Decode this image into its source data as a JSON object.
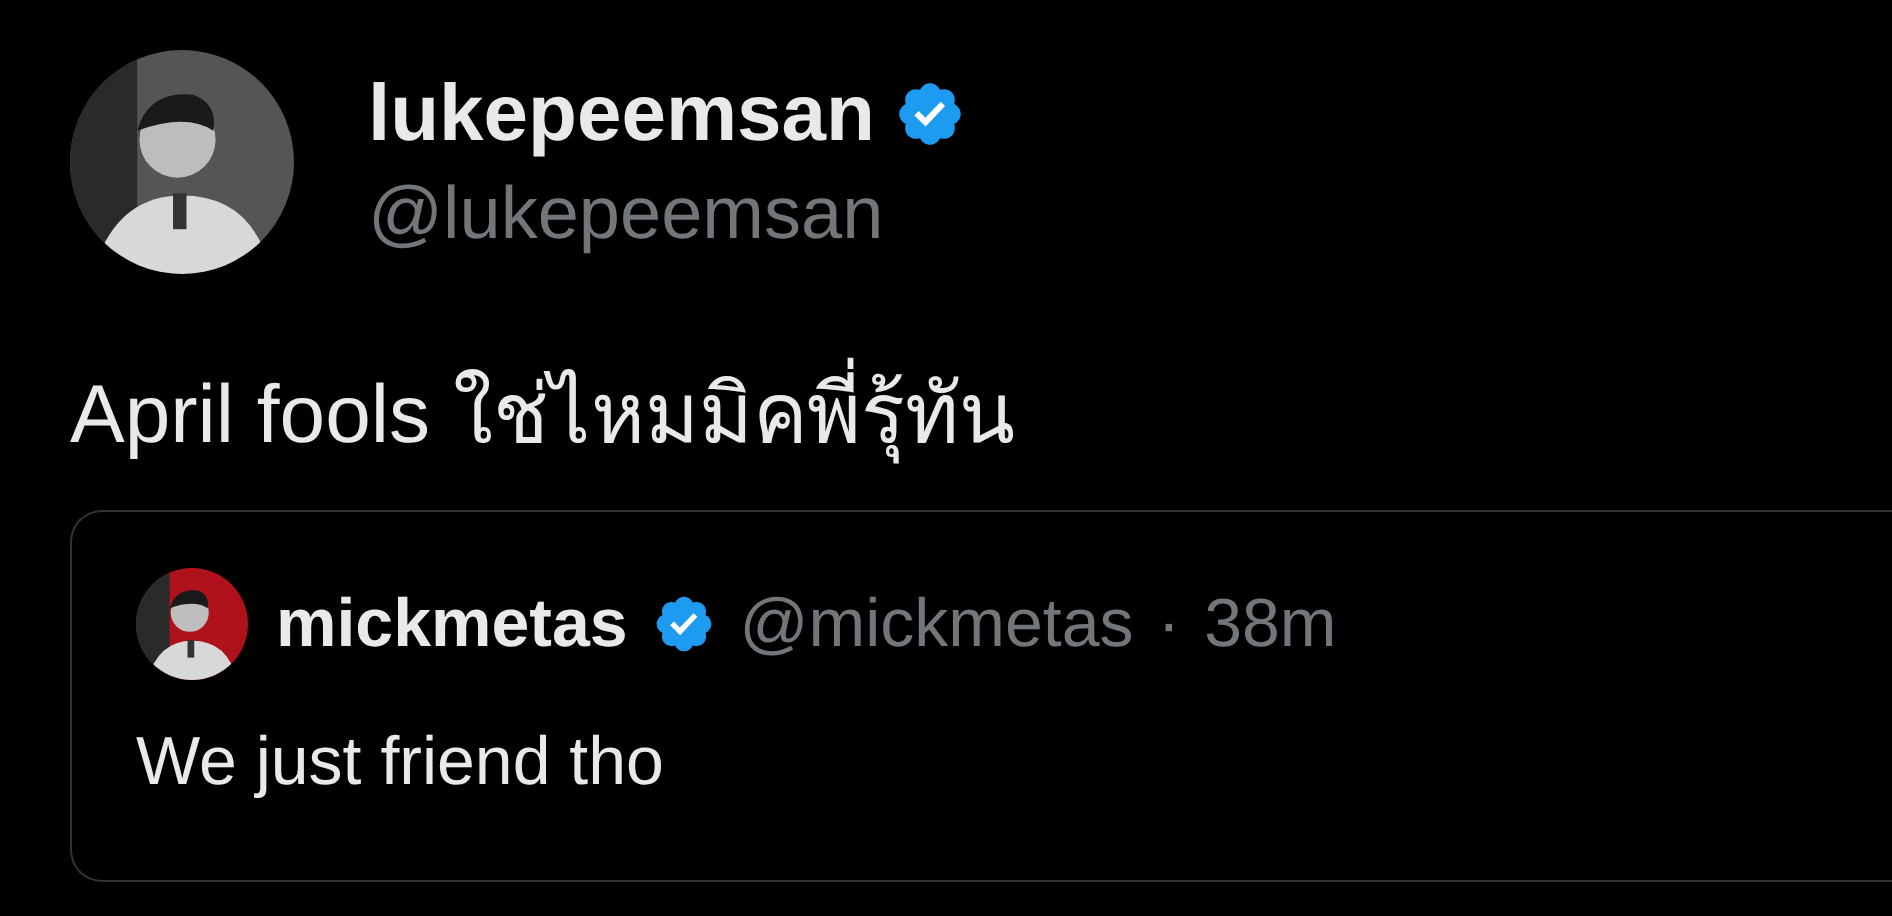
{
  "author": {
    "name": "lukepeemsan",
    "verified": true,
    "handle": "@lukepeemsan"
  },
  "text": "April fools ใช่ไหมมิคพี่รุ้ทัน",
  "quoted": {
    "name": "mickmetas",
    "verified": true,
    "handle": "@mickmetas",
    "separator": "·",
    "time": "38m",
    "text": "We just friend tho"
  }
}
